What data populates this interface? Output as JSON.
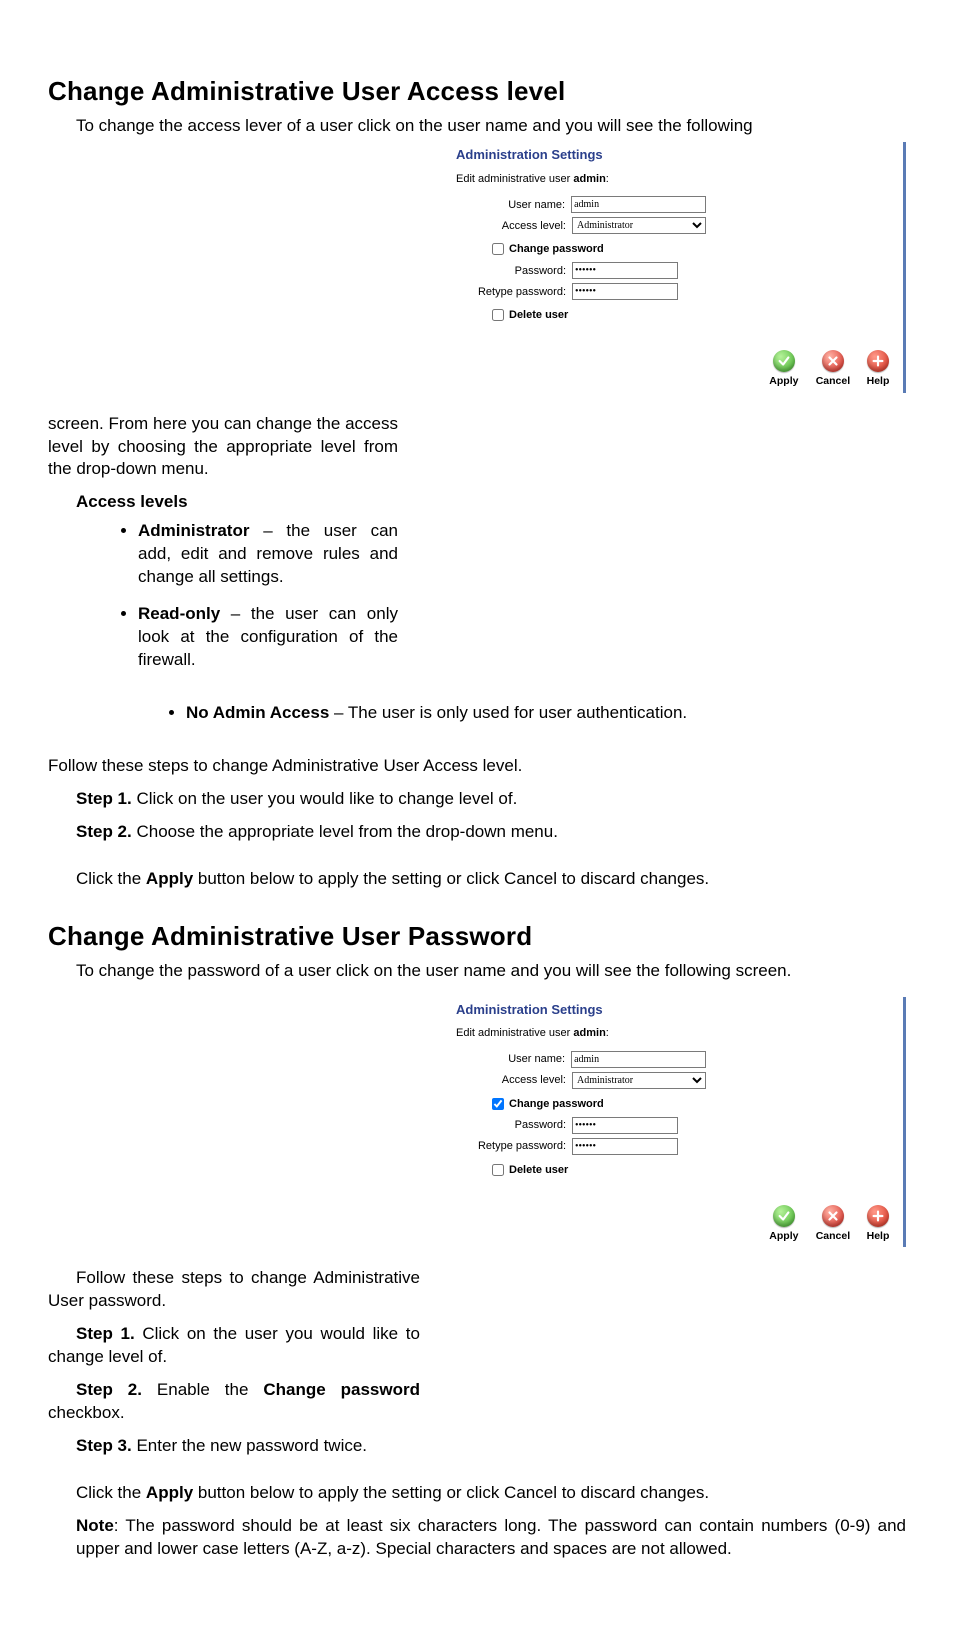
{
  "section1": {
    "heading": "Change Administrative User Access level",
    "intro_full": "To change the access lever of a user click on the user name and you will see the following",
    "intro_wrap": "screen. From here you can change the access level by choosing the appropriate level from the drop-down menu.",
    "access_levels_label": "Access levels",
    "levels": {
      "admin_label": "Administrator",
      "admin_desc": " – the user can add, edit and remove rules and change all settings.",
      "ro_label": "Read-only",
      "ro_desc": " – the user can only look at the configuration of the firewall.",
      "na_label": "No Admin Access",
      "na_desc": " – The user is only used for user authentication."
    },
    "follow_line": "Follow these steps to change Administrative User Access level.",
    "step1_b": "Step 1.",
    "step1_t": " Click on the user you would like to change level of.",
    "step2_b": "Step 2.",
    "step2_t": " Choose the appropriate level from the drop-down menu.",
    "apply_line_a": "Click the ",
    "apply_line_b": "Apply",
    "apply_line_c": " button below to apply the setting or click Cancel to discard changes."
  },
  "section2": {
    "heading": "Change Administrative User Password",
    "intro": "To change the password of a user click on the user name and you will see the following screen.",
    "follow": "Follow these steps to change Administrative User password.",
    "s1b": "Step 1.",
    "s1t": " Click on the user you would like to change level of.",
    "s2b": "Step 2.",
    "s2t_a": " Enable the ",
    "s2t_b": "Change password",
    "s2t_c": " checkbox.",
    "s3b": "Step 3.",
    "s3t": " Enter the new password twice.",
    "apply_a": "Click the ",
    "apply_b": "Apply",
    "apply_c": " button below to apply the setting or click Cancel to discard changes.",
    "note_b": "Note",
    "note_t": ": The password should be at least six characters long. The password can contain numbers (0-9) and upper and lower case letters (A-Z, a-z). Special characters and spaces are not allowed."
  },
  "panel": {
    "title": "Administration Settings",
    "sub_a": "Edit administrative user ",
    "sub_b": "admin",
    "sub_c": ":",
    "lbl_user": "User name:",
    "val_user": "admin",
    "lbl_level": "Access level:",
    "val_level": "Administrator",
    "chk_change": "Change password",
    "lbl_pw": "Password:",
    "val_pw": "••••••",
    "lbl_pw2": "Retype password:",
    "val_pw2": "••••••",
    "chk_delete": "Delete user",
    "btn_apply": "Apply",
    "btn_cancel": "Cancel",
    "btn_help": "Help"
  }
}
